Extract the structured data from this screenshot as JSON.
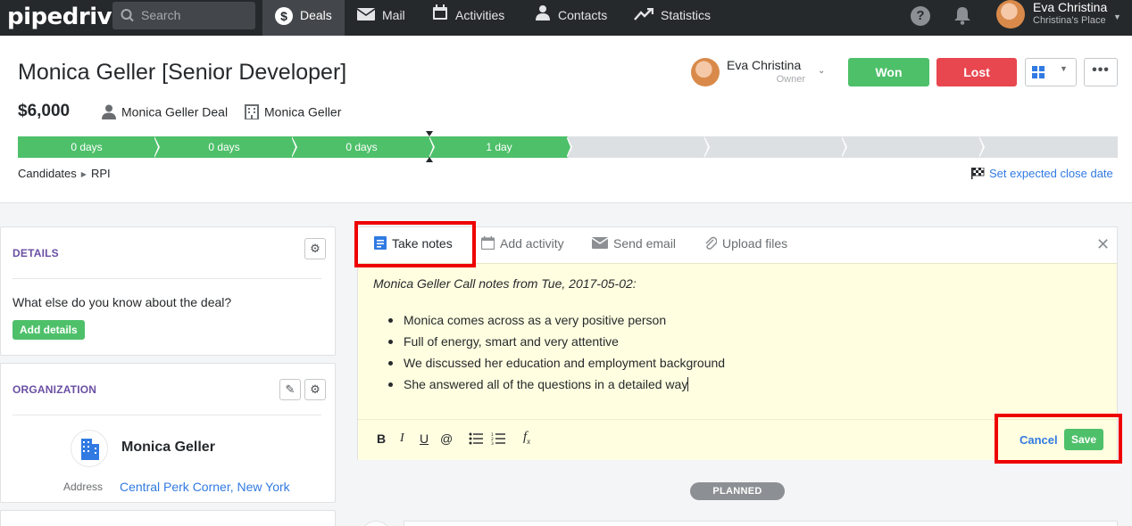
{
  "nav": {
    "logo": "pipedrive",
    "search_placeholder": "Search",
    "items": [
      {
        "label": "Deals",
        "icon": "dollar-icon",
        "active": true
      },
      {
        "label": "Mail",
        "icon": "mail-icon"
      },
      {
        "label": "Activities",
        "icon": "calendar-icon"
      },
      {
        "label": "Contacts",
        "icon": "person-icon"
      },
      {
        "label": "Statistics",
        "icon": "trend-icon"
      }
    ],
    "help": "?",
    "user": {
      "name": "Eva Christina",
      "company": "Christina's Place"
    }
  },
  "deal": {
    "title": "Monica Geller [Senior Developer]",
    "value": "$6,000",
    "person": "Monica Geller Deal",
    "organization": "Monica Geller",
    "owner": {
      "name": "Eva Christina",
      "label": "Owner"
    },
    "won_label": "Won",
    "lost_label": "Lost",
    "more_label": "•••",
    "stages": [
      {
        "label": "0 days",
        "state": "done"
      },
      {
        "label": "0 days",
        "state": "done"
      },
      {
        "label": "0 days",
        "state": "done"
      },
      {
        "label": "1 day",
        "state": "done"
      },
      {
        "label": "",
        "state": "todo"
      },
      {
        "label": "",
        "state": "todo"
      },
      {
        "label": "",
        "state": "todo"
      },
      {
        "label": "",
        "state": "todo"
      }
    ],
    "breadcrumb": [
      "Candidates",
      "RPI"
    ],
    "close_date_link": "Set expected close date"
  },
  "details_panel": {
    "title": "DETAILS",
    "question": "What else do you know about the deal?",
    "add_button": "Add details"
  },
  "org_panel": {
    "title": "ORGANIZATION",
    "name": "Monica Geller",
    "address_label": "Address",
    "address": "Central Perk Corner, New York"
  },
  "composer": {
    "tabs": [
      {
        "label": "Take notes",
        "icon": "note-icon",
        "active": true
      },
      {
        "label": "Add activity",
        "icon": "calendar-icon"
      },
      {
        "label": "Send email",
        "icon": "mail-icon"
      },
      {
        "label": "Upload files",
        "icon": "paperclip-icon"
      }
    ],
    "close": "✕",
    "note_heading": "Monica Geller Call notes from Tue, 2017-05-02:",
    "note_items": [
      "Monica comes across as a very positive person",
      "Full of energy, smart and very attentive",
      "We discussed her education and employment background",
      "She answered all of the questions in a detailed way"
    ],
    "toolbar": {
      "bold": "B",
      "italic": "I",
      "underline": "U",
      "mention": "@"
    },
    "cancel_label": "Cancel",
    "save_label": "Save"
  },
  "timeline": {
    "planned_label": "PLANNED"
  },
  "colors": {
    "highlight": "#e00000",
    "won": "#4ec06a",
    "lost": "#e8474f",
    "link": "#317ae2"
  }
}
